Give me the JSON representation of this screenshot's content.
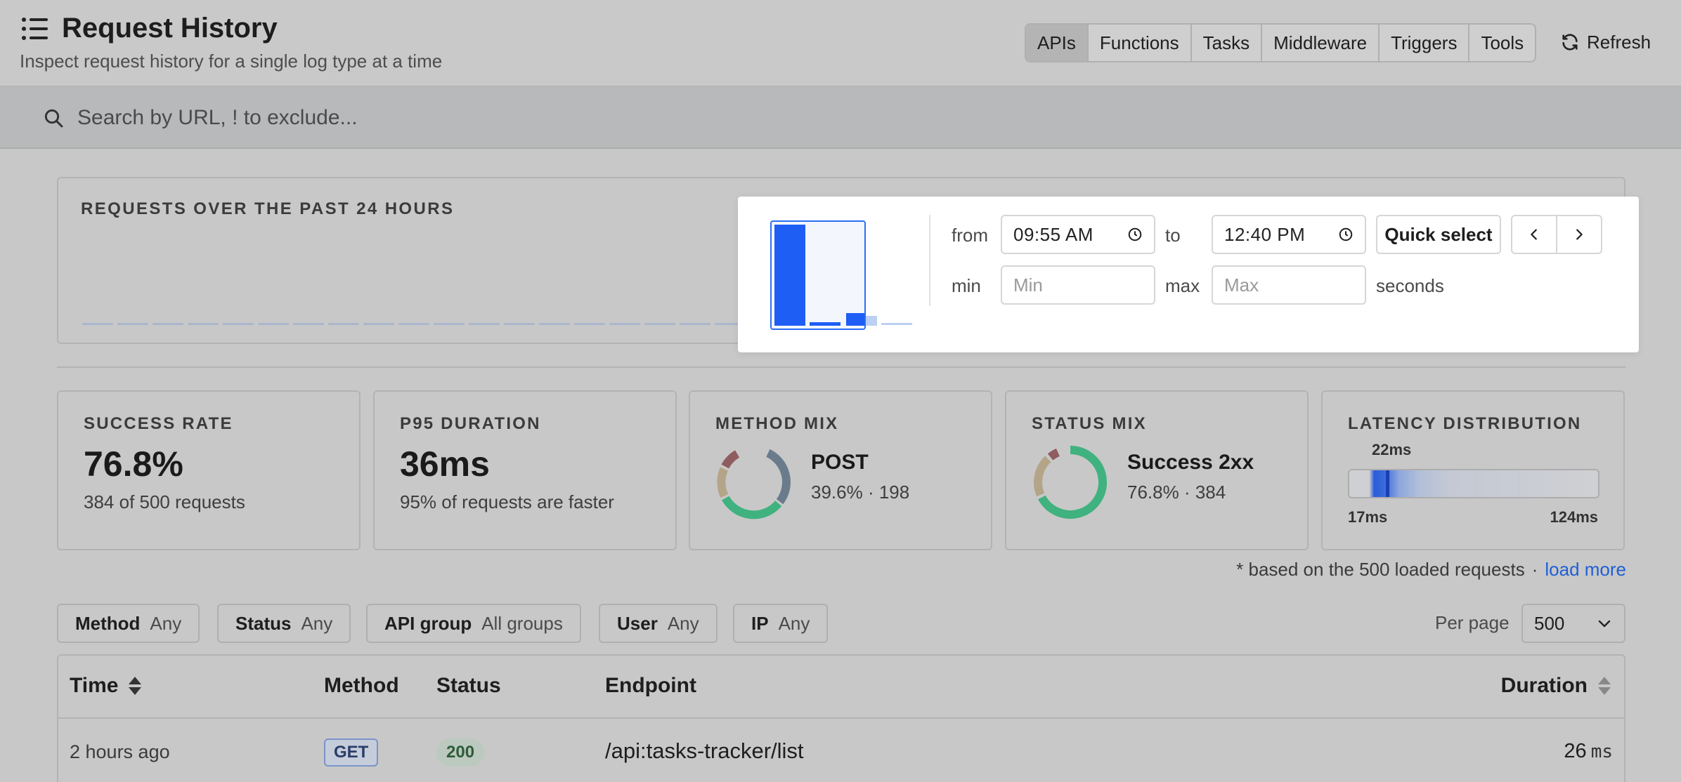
{
  "header": {
    "title": "Request History",
    "subtitle": "Inspect request history for a single log type at a time",
    "tabs": [
      {
        "label": "APIs",
        "active": true
      },
      {
        "label": "Functions"
      },
      {
        "label": "Tasks"
      },
      {
        "label": "Middleware"
      },
      {
        "label": "Triggers"
      },
      {
        "label": "Tools"
      }
    ],
    "refresh_label": "Refresh"
  },
  "search": {
    "placeholder": "Search by URL, ! to exclude..."
  },
  "chart": {
    "title": "REQUESTS OVER THE PAST 24 HOURS",
    "accent_color": "#1f5ef5"
  },
  "time_filter": {
    "from_label": "from",
    "from_value": "09:55  AM",
    "to_label": "to",
    "to_value": "12:40  PM",
    "min_label": "min",
    "min_placeholder": "Min",
    "max_label": "max",
    "max_placeholder": "Max",
    "unit_label": "seconds",
    "quick_select_label": "Quick select"
  },
  "stats": {
    "success_rate": {
      "label": "SUCCESS RATE",
      "value": "76.8%",
      "sub": "384 of 500 requests"
    },
    "p95": {
      "label": "P95 DURATION",
      "value": "36ms",
      "sub": "95% of requests are faster"
    },
    "method_mix": {
      "label": "METHOD MIX",
      "name": "POST",
      "sub": "39.6% · 198"
    },
    "status_mix": {
      "label": "STATUS MIX",
      "name": "Success 2xx",
      "sub": "76.8% · 384"
    },
    "latency": {
      "label": "LATENCY DISTRIBUTION",
      "marker": "22ms",
      "min": "17ms",
      "max": "124ms"
    }
  },
  "note": {
    "text": "* based on the 500 loaded requests",
    "separator": "·",
    "link": "load more"
  },
  "filters": [
    {
      "key": "Method",
      "value": "Any"
    },
    {
      "key": "Status",
      "value": "Any"
    },
    {
      "key": "API group",
      "value": "All groups"
    },
    {
      "key": "User",
      "value": "Any"
    },
    {
      "key": "IP",
      "value": "Any"
    }
  ],
  "per_page": {
    "label": "Per page",
    "value": "500"
  },
  "table": {
    "columns": [
      "Time",
      "Method",
      "Status",
      "Endpoint",
      "Duration"
    ],
    "rows": [
      {
        "time": "2 hours ago",
        "method": "GET",
        "status": "200",
        "endpoint": "/api:tasks-tracker/list",
        "duration": "26",
        "unit": "ms"
      }
    ]
  },
  "colors": {
    "accent": "#1f5ef5",
    "success": "#3fb27f",
    "link": "#1f5fd6"
  }
}
